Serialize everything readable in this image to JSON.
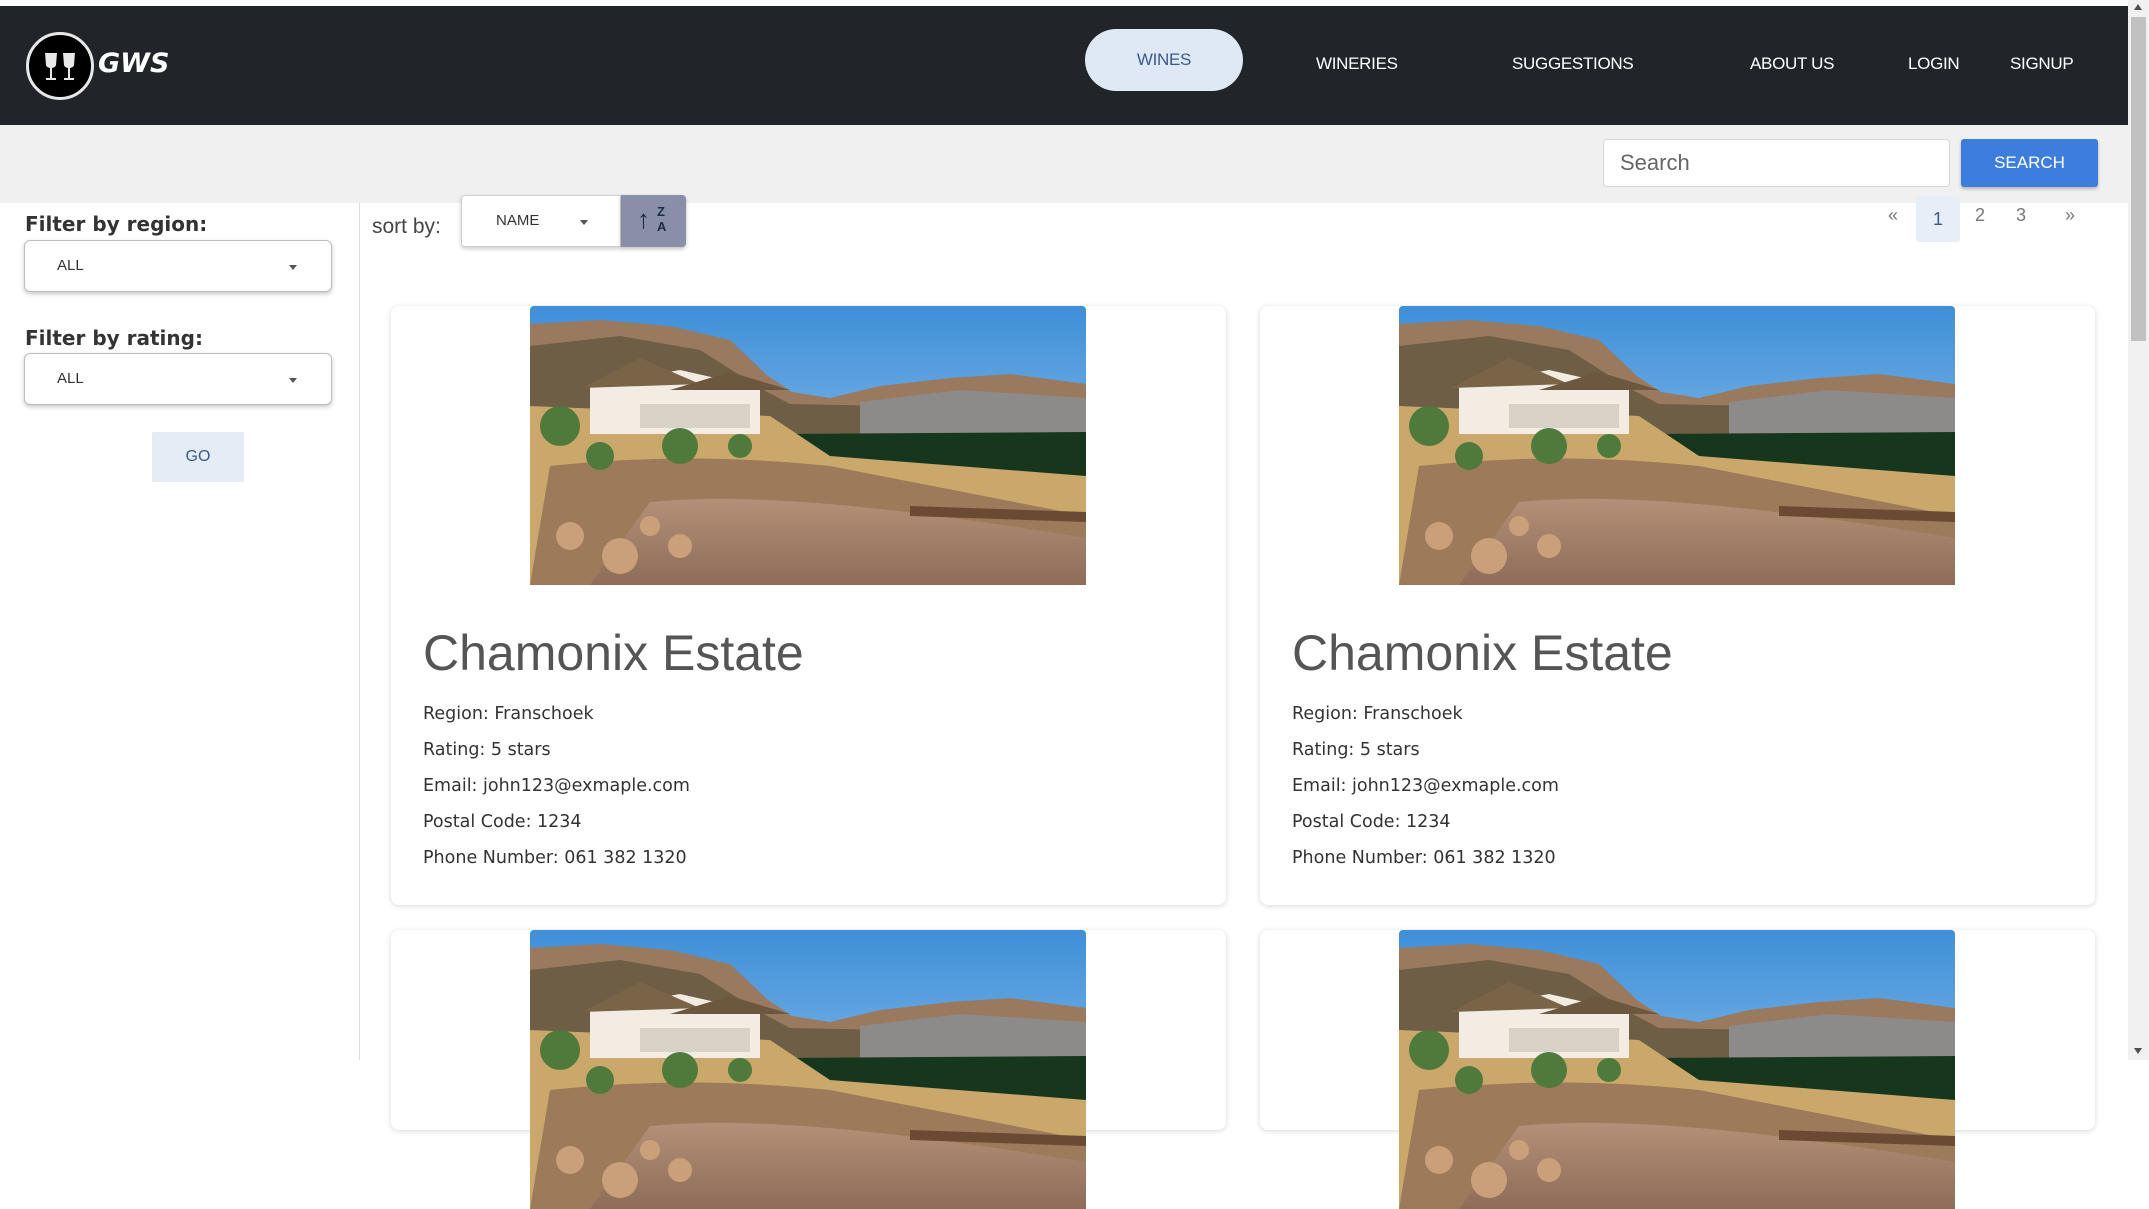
{
  "nav": {
    "brand": "GWS",
    "items": [
      "WINES",
      "WINERIES",
      "SUGGESTIONS",
      "ABOUT US",
      "LOGIN",
      "SIGNUP"
    ],
    "active_index": 0
  },
  "search": {
    "placeholder": "Search",
    "button_label": "SEARCH"
  },
  "filters": {
    "region_label": "Filter by region:",
    "region_value": "ALL",
    "rating_label": "Filter by rating:",
    "rating_value": "ALL",
    "go_label": "GO"
  },
  "sort": {
    "label": "sort by:",
    "value": "NAME",
    "dir_letter_top": "Z",
    "dir_letter_bottom": "A"
  },
  "pagination": {
    "prev": "«",
    "pages": [
      "1",
      "2",
      "3"
    ],
    "current": "1",
    "next": "»"
  },
  "wineries": [
    {
      "name": "Chamonix Estate",
      "region": "Region: Franschoek",
      "rating": "Rating: 5 stars",
      "email": "Email: john123@exmaple.com",
      "postal": "Postal Code: 1234",
      "phone": "Phone Number: 061 382 1320"
    },
    {
      "name": "Chamonix Estate",
      "region": "Region: Franschoek",
      "rating": "Rating: 5 stars",
      "email": "Email: john123@exmaple.com",
      "postal": "Postal Code: 1234",
      "phone": "Phone Number: 061 382 1320"
    }
  ],
  "colors": {
    "navbar": "#212529",
    "accent": "#3d7ddc",
    "active_pill": "#dfe8f5"
  }
}
